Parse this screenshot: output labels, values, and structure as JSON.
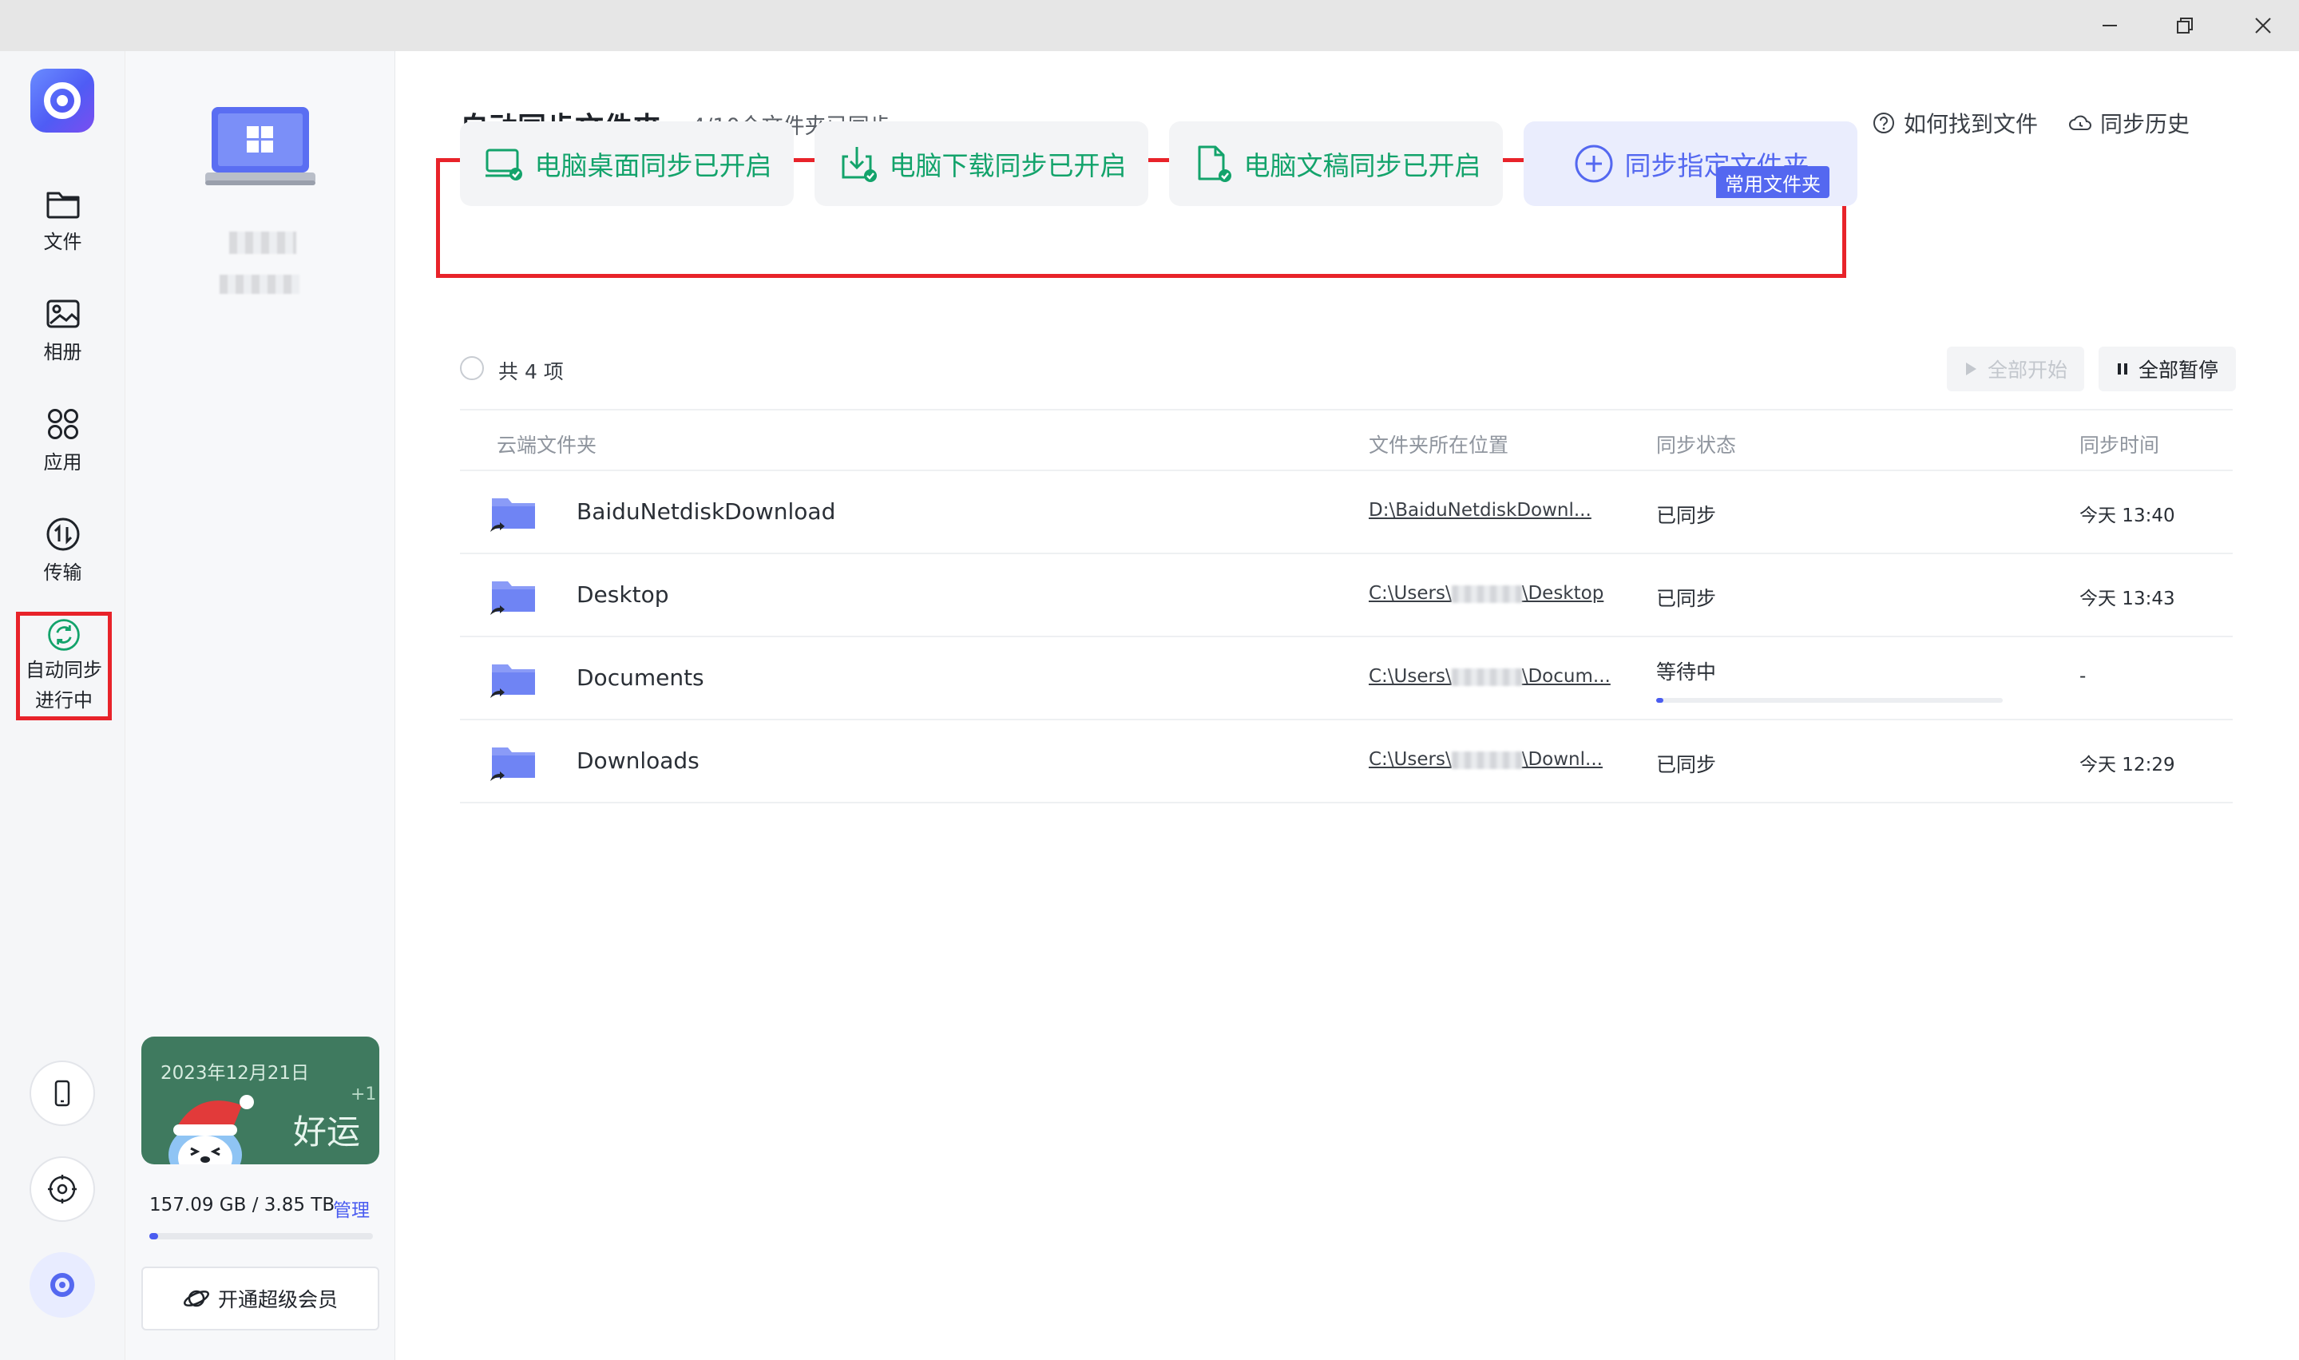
{
  "window": {
    "minimize": "minimize",
    "restore": "restore",
    "close": "close"
  },
  "nav": {
    "items": [
      {
        "label": "文件",
        "icon": "folder-icon"
      },
      {
        "label": "相册",
        "icon": "photo-icon"
      },
      {
        "label": "应用",
        "icon": "apps-icon"
      },
      {
        "label": "传输",
        "icon": "transfer-icon"
      }
    ],
    "active": {
      "label_line1": "自动同步",
      "label_line2": "进行中",
      "icon": "sync-icon"
    },
    "bottom_icons": [
      "phone-icon",
      "settings-icon",
      "avatar-icon"
    ]
  },
  "sidebar": {
    "greeting_card": {
      "date": "2023年12月21日",
      "plus": "+1",
      "word": "好运"
    },
    "storage_text": "157.09 GB / 3.85 TB",
    "storage_used_fraction": 0.04,
    "manage_label": "管理",
    "vip_label": "开通超级会员"
  },
  "header": {
    "title": "自动同步文件夹",
    "subtitle": "4/10个文件夹已同步",
    "help_link": "如何找到文件",
    "history_link": "同步历史"
  },
  "quick_cards": {
    "desktop": "电脑桌面同步已开启",
    "download": "电脑下载同步已开启",
    "documents": "电脑文稿同步已开启",
    "add": "同步指定文件夹",
    "badge": "常用文件夹"
  },
  "list": {
    "count_label": "共 4 项",
    "start_all": "全部开始",
    "pause_all": "全部暂停",
    "columns": {
      "name": "云端文件夹",
      "location": "文件夹所在位置",
      "status": "同步状态",
      "time": "同步时间"
    },
    "rows": [
      {
        "name": "BaiduNetdiskDownload",
        "path_prefix": "D:\\BaiduNetdiskDownl...",
        "path_suffix": "",
        "status": "已同步",
        "time": "今天 13:40"
      },
      {
        "name": "Desktop",
        "path_prefix": "C:\\Users\\",
        "path_suffix": "\\Desktop",
        "status": "已同步",
        "time": "今天 13:43"
      },
      {
        "name": "Documents",
        "path_prefix": "C:\\Users\\",
        "path_suffix": "\\Docum...",
        "status": "等待中",
        "time": "-",
        "progress": 0.02
      },
      {
        "name": "Downloads",
        "path_prefix": "C:\\Users\\",
        "path_suffix": "\\Downl...",
        "status": "已同步",
        "time": "今天 12:29"
      }
    ]
  },
  "colors": {
    "accent": "#4a5cf0",
    "green": "#13a36b",
    "highlight_red": "#e8232a"
  }
}
